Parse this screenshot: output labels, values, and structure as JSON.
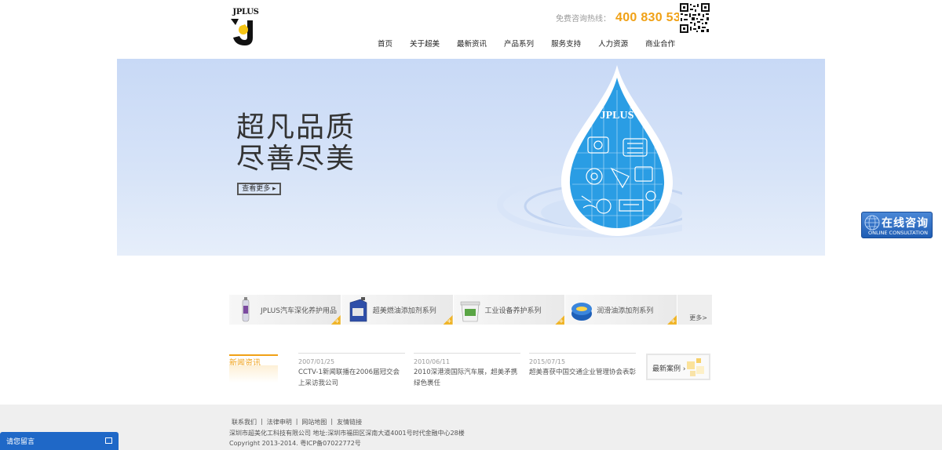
{
  "header": {
    "logo_text": "JPLUS",
    "hotline_label": "免费咨询热线：",
    "hotline_number": "400 830 5308"
  },
  "nav": {
    "items": [
      "首页",
      "关于超美",
      "最新资讯",
      "产品系列",
      "服务支持",
      "人力资源",
      "商业合作"
    ]
  },
  "banner": {
    "slogan_line1": "超凡品质",
    "slogan_line2": "尽善尽美",
    "more_button": "查看更多",
    "drop_brand": "JPLUS"
  },
  "products": {
    "items": [
      {
        "label": "JPLUS汽车深化养护用品",
        "icon": "spray-can-icon"
      },
      {
        "label": "超美燃油添加剂系列",
        "icon": "oil-bottle-icon"
      },
      {
        "label": "工业设备养护系列",
        "icon": "bucket-icon"
      },
      {
        "label": "润滑油添加剂系列",
        "icon": "tin-can-icon"
      }
    ],
    "more": "更多>"
  },
  "news": {
    "section_title": "新闻资讯",
    "items": [
      {
        "date": "2007/01/25",
        "title": "CCTV-1新闻联播在2006届冠交会上采访我公司"
      },
      {
        "date": "2010/06/11",
        "title": "2010深港澳国际汽车展，超美矛携绿色裹任"
      },
      {
        "date": "2015/07/15",
        "title": "超美喜获中国交通企业管理协会表彰"
      }
    ],
    "case_label": "最新案例"
  },
  "footer": {
    "links": [
      "联系我们",
      "法律申明",
      "网站地图",
      "友情链接"
    ],
    "address": "深圳市超美化工科技有限公司 地址:深圳市福田区深南大道4001号时代金融中心28楼",
    "copyright": "Copyright  2013-2014. 粤ICP备07022772号"
  },
  "floating": {
    "leave_message": "请您留言",
    "online_big": "在线咨询",
    "online_small": "ONLINE CONSULTATION"
  },
  "colors": {
    "accent": "#f0a116",
    "banner_bg": "#cddcf6",
    "drop_blue": "#2a9de4",
    "chat_blue": "#1f68c7"
  }
}
